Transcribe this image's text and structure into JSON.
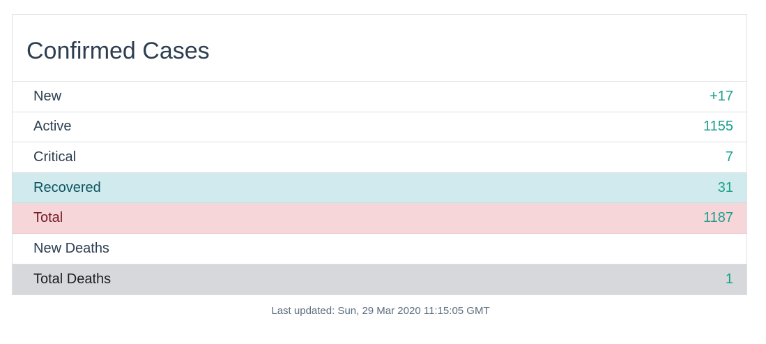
{
  "card": {
    "title": "Confirmed Cases"
  },
  "rows": [
    {
      "label": "New",
      "value": "+17"
    },
    {
      "label": "Active",
      "value": "1155"
    },
    {
      "label": "Critical",
      "value": "7"
    },
    {
      "label": "Recovered",
      "value": "31"
    },
    {
      "label": "Total",
      "value": "1187"
    },
    {
      "label": "New Deaths",
      "value": ""
    },
    {
      "label": "Total Deaths",
      "value": "1"
    }
  ],
  "footer": {
    "last_updated": "Last updated: Sun, 29 Mar 2020 11:15:05 GMT"
  },
  "colors": {
    "value_text": "#18a08c",
    "recovered_row_bg": "#d1eaee",
    "total_row_bg": "#f7d6d9",
    "total_deaths_row_bg": "#d6d8db"
  }
}
